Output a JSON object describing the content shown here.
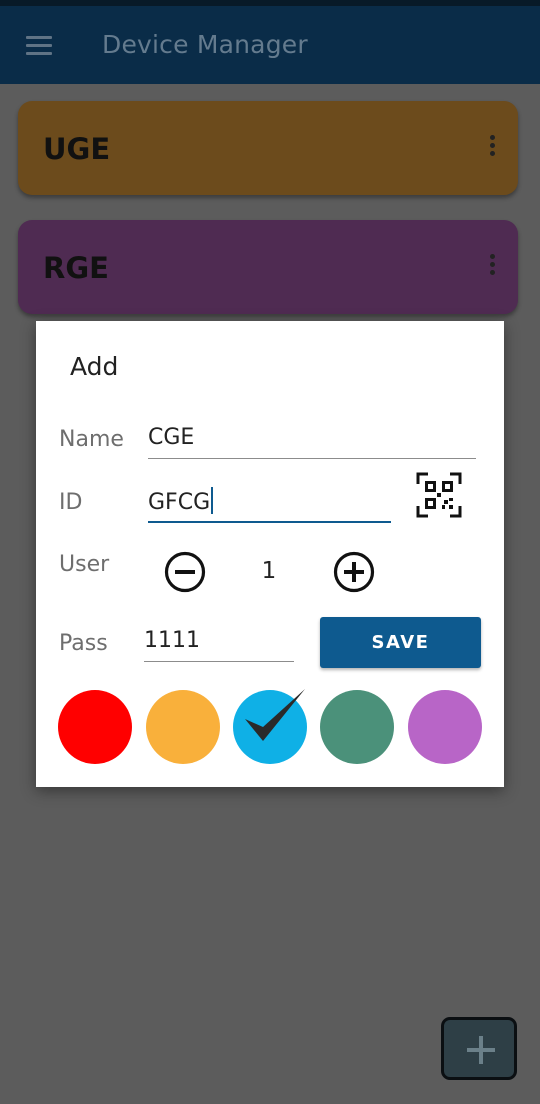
{
  "app": {
    "title": "Device Manager"
  },
  "devices": [
    {
      "name": "UGE"
    },
    {
      "name": "RGE"
    }
  ],
  "dialog": {
    "title": "Add",
    "name_label": "Name",
    "name_value": "CGE",
    "id_label": "ID",
    "id_value": "GFCG",
    "user_label": "User",
    "user_count": "1",
    "pass_label": "Pass",
    "pass_value": "1111",
    "save_label": "SAVE",
    "colors": [
      "#ff0000",
      "#f9b03b",
      "#0fb0e6",
      "#4b917a",
      "#b865c7"
    ],
    "selected_color_index": 2
  },
  "icons": {
    "menu": "hamburger-menu-icon",
    "more": "more-vertical-icon",
    "qr": "qr-scan-icon",
    "minus": "minus-circle-icon",
    "plus": "plus-circle-icon",
    "check": "check-icon",
    "add": "add-icon"
  }
}
